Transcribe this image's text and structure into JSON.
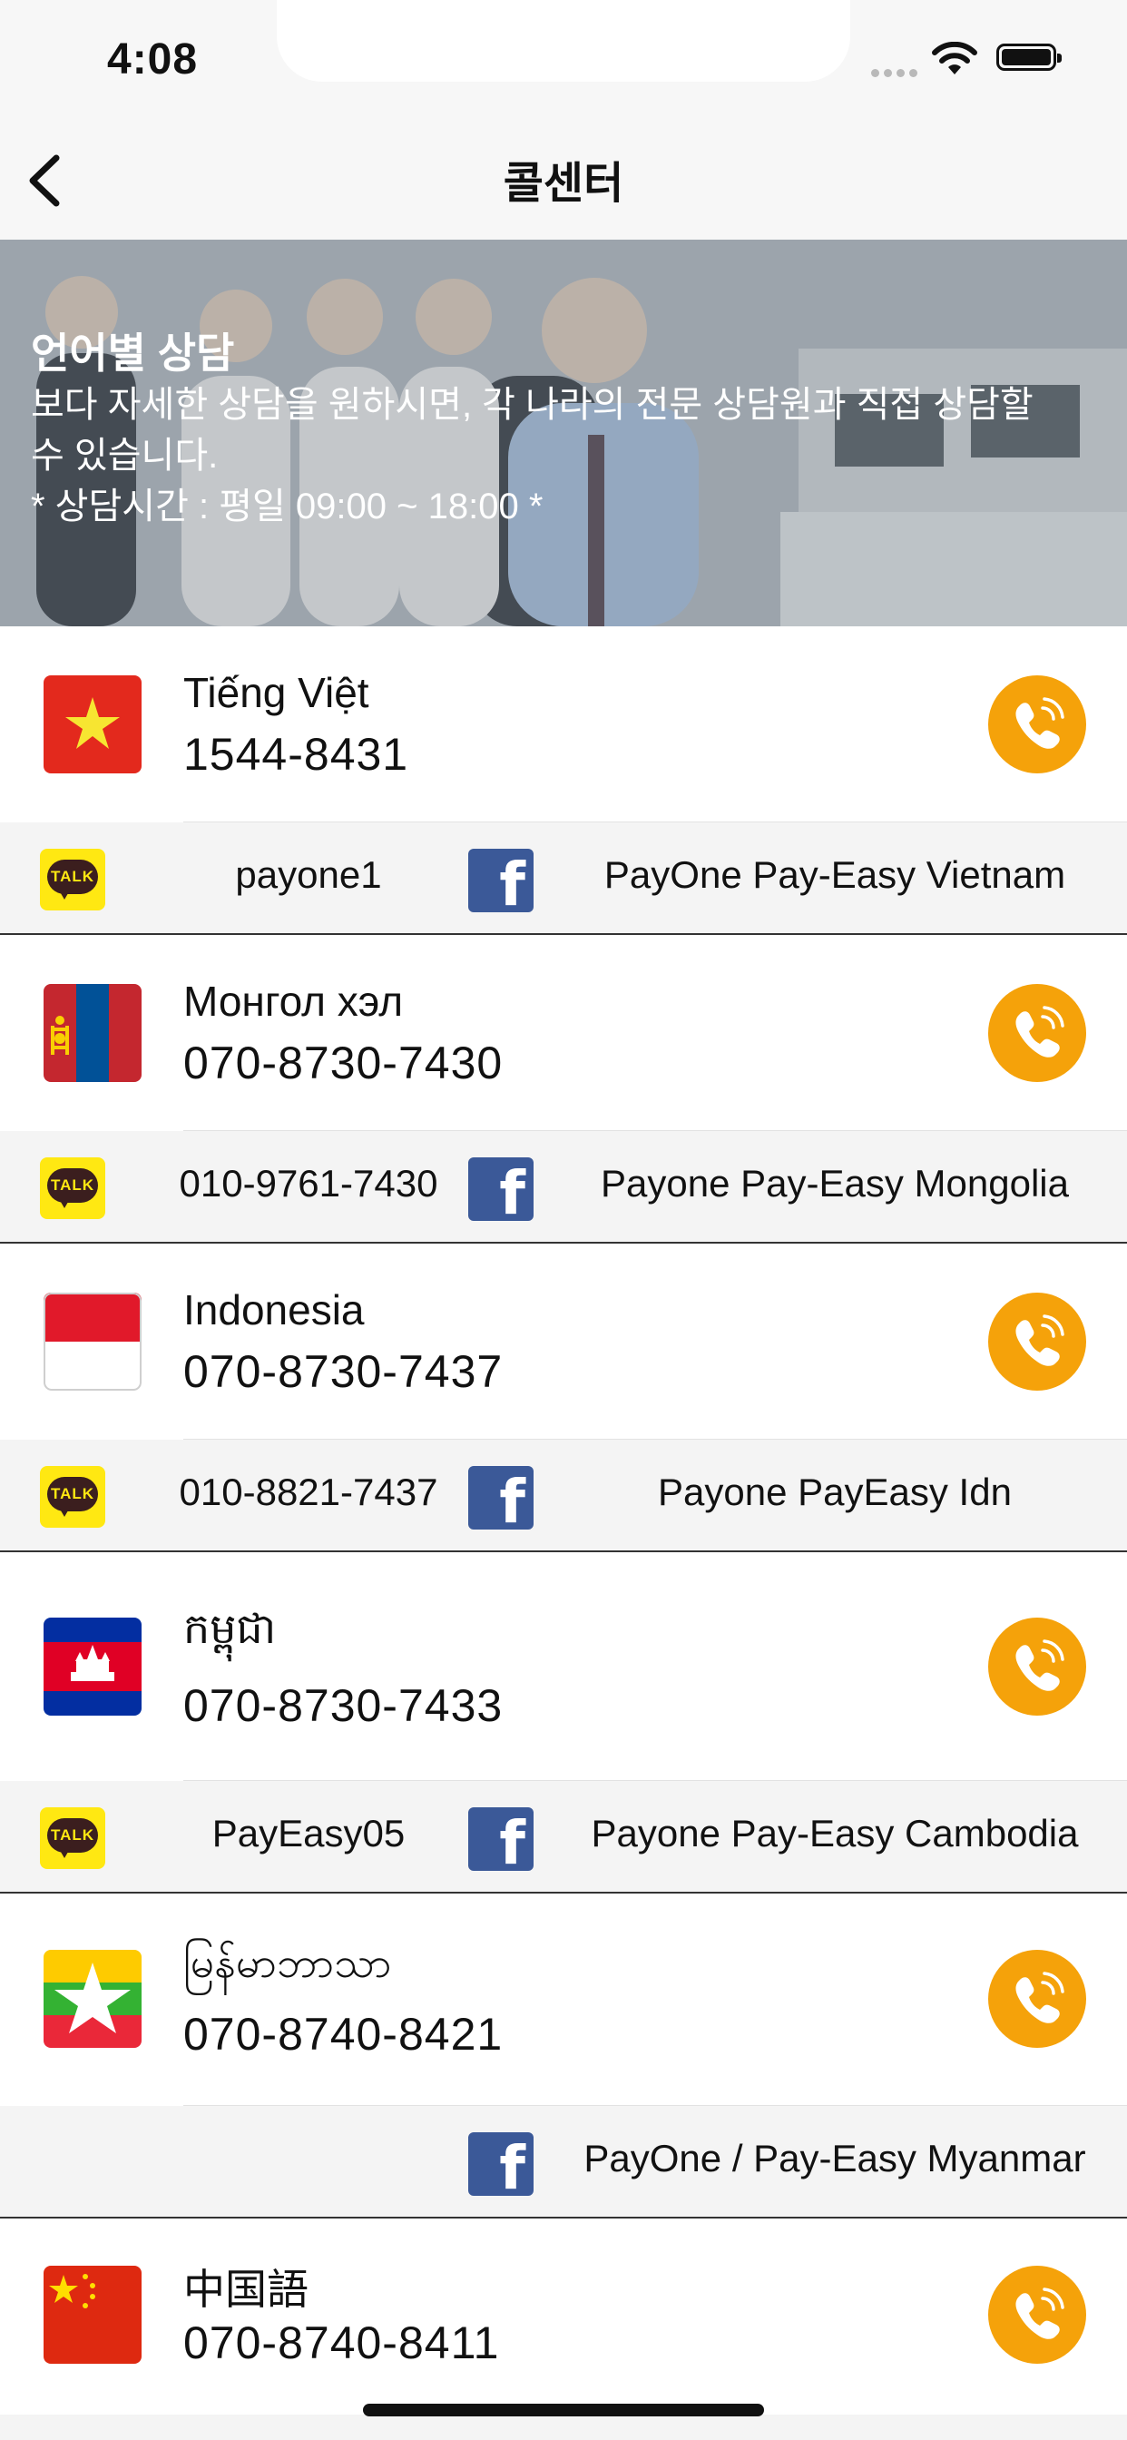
{
  "status_bar": {
    "time": "4:08"
  },
  "nav": {
    "title": "콜센터"
  },
  "hero": {
    "heading": "언어별 상담",
    "line1": "보다 자세한 상담을 원하시면, 각 나라의 전문 상담원과 직접 상담할",
    "line2": "수 있습니다.",
    "hours": "* 상담시간 : 평일 09:00 ~ 18:00 *"
  },
  "contacts": [
    {
      "language": "Tiếng Việt",
      "phone": "1544-8431",
      "kakao": "payone1",
      "facebook": "PayOne Pay-Easy Vietnam"
    },
    {
      "language": "Монгол хэл",
      "phone": "070-8730-7430",
      "kakao": "010-9761-7430",
      "facebook": "Payone Pay-Easy Mongolia"
    },
    {
      "language": "Indonesia",
      "phone": "070-8730-7437",
      "kakao": "010-8821-7437",
      "facebook": "Payone PayEasy Idn"
    },
    {
      "language": "កម្ពុជា",
      "phone": "070-8730-7433",
      "kakao": "PayEasy05",
      "facebook": "Payone Pay-Easy Cambodia"
    },
    {
      "language": "မြန်မာဘာသာ",
      "phone": "070-8740-8421",
      "kakao": "",
      "facebook": "PayOne / Pay-Easy Myanmar"
    },
    {
      "language": "中国語",
      "phone": "070-8740-8411"
    }
  ],
  "icons": {
    "kakao_label": "TALK",
    "facebook_glyph": "f",
    "call_color": "#f5a20a"
  }
}
